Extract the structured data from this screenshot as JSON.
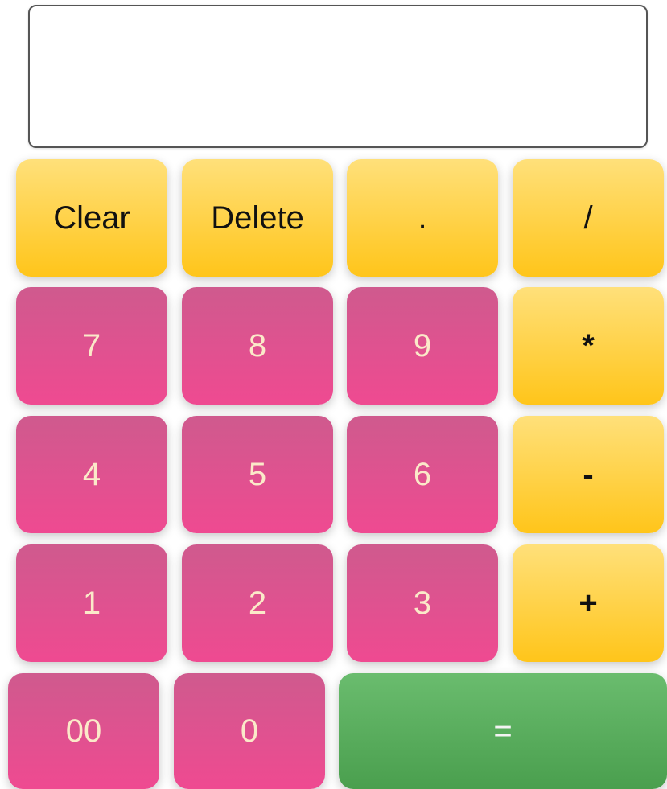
{
  "display": {
    "value": ""
  },
  "buttons": {
    "clear": "Clear",
    "delete": "Delete",
    "dot": ".",
    "divide": "/",
    "seven": "7",
    "eight": "8",
    "nine": "9",
    "multiply": "*",
    "four": "4",
    "five": "5",
    "six": "6",
    "subtract": "-",
    "one": "1",
    "two": "2",
    "three": "3",
    "add": "+",
    "double_zero": "00",
    "zero": "0",
    "equals": "="
  },
  "colors": {
    "operator": "#ffc51a",
    "number": "#e14d8e",
    "equals": "#55aa59"
  }
}
